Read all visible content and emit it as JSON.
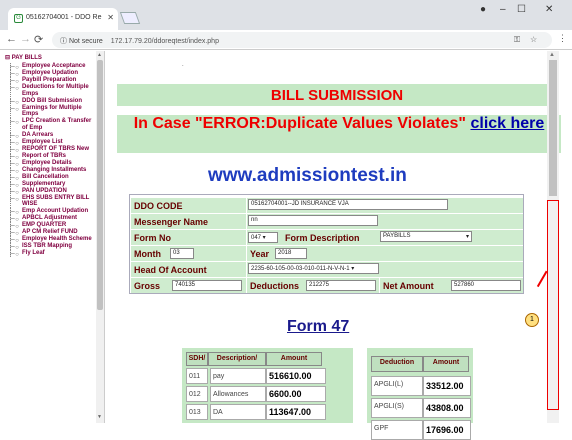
{
  "browser": {
    "tab_title": "05162704001 - DDO Re",
    "url_prefix": "Not secure",
    "url": "172.17.79.20/ddoreqtest/index.php"
  },
  "sidebar": {
    "root": "PAY BILLS",
    "items": [
      "Employee Acceptance",
      "Employee Updation",
      "Paybill Preparation",
      "Deductions for Multiple Emps",
      "DDO Bill Submission",
      "Earnings for Multiple Emps",
      "LPC Creation & Transfer of Emp",
      "DA Arrears",
      "Employee List",
      "REPORT OF TBRS New",
      "Report of TBRs",
      "Employee Details",
      "Changing Installments",
      "Bill Cancellation",
      "Supplementary",
      "PAN UPDATION",
      "EHS SUBS ENTRY BILL WISE",
      "Emp Account Updation",
      "APBCL Adjustment",
      "EMP QUARTER",
      "AP CM Relief FUND",
      "Employe Health Scheme",
      "ISS TBR Mapping",
      "Fly Leaf"
    ]
  },
  "content": {
    "dot": ".",
    "title": "BILL SUBMISSION",
    "error_prefix": "In Case \"ERROR:Duplicate Values Violates\"",
    "error_link": "click here",
    "site": "www.admissiontest.in",
    "form": {
      "ddo_label": "DDO CODE",
      "ddo_value": "05162704001--JD INSURANCE VJA",
      "msg_label": "Messenger Name",
      "msg_value": "nn",
      "formno_label": "Form No",
      "formno_value": "047",
      "formdesc_label": "Form Description",
      "formdesc_value": "PAYBILLS",
      "month_label": "Month",
      "month_value": "03",
      "year_label": "Year",
      "year_value": "2018",
      "hoa_label": "Head Of Account",
      "hoa_value": "2235-60-105-00-03-010-011-N-V-N-1",
      "gross_label": "Gross",
      "gross_value": "740135",
      "ded_label": "Deductions",
      "ded_value": "212275",
      "net_label": "Net Amount",
      "net_value": "527860"
    },
    "form_heading": "Form 47",
    "left_table": {
      "headers": [
        "SDH/",
        "Description/",
        "Amount"
      ],
      "rows": [
        [
          "011",
          "pay",
          "516610.00"
        ],
        [
          "012",
          "Allowances",
          "6600.00"
        ],
        [
          "013",
          "DA",
          "113647.00"
        ]
      ]
    },
    "right_table": {
      "headers": [
        "Deduction",
        "Amount"
      ],
      "rows": [
        [
          "APGLI(L)",
          "33512.00"
        ],
        [
          "APGLI(S)",
          "43808.00"
        ],
        [
          "GPF",
          "17696.00"
        ]
      ]
    },
    "annotation": "1"
  }
}
